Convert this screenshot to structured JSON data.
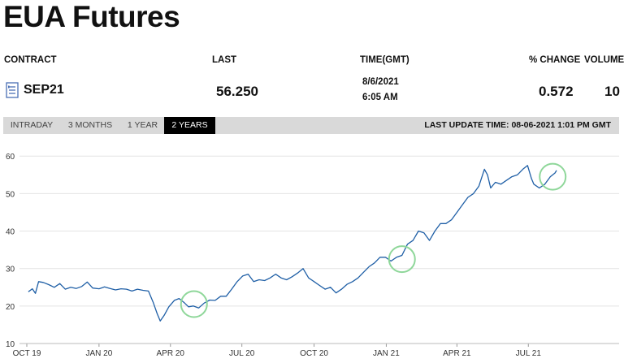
{
  "page_title": "EUA Futures",
  "table": {
    "headers": {
      "contract": "CONTRACT",
      "last": "LAST",
      "time": "TIME(GMT)",
      "change": "% CHANGE",
      "volume": "VOLUME"
    },
    "row": {
      "contract": "SEP21",
      "last": "56.250",
      "date": "8/6/2021",
      "time": "6:05 AM",
      "change": "0.572",
      "volume": "10"
    }
  },
  "tabs": [
    "INTRADAY",
    "3 MONTHS",
    "1 YEAR",
    "2 YEARS"
  ],
  "active_tab": "2 YEARS",
  "last_update": "LAST UPDATE TIME: 08-06-2021 1:01 PM GMT",
  "colors": {
    "line": "#1f5fa6",
    "highlight": "#8fd79a",
    "grid": "#e4e4e4"
  },
  "chart_data": {
    "type": "line",
    "title": "",
    "xlabel": "",
    "ylabel": "",
    "ylim": [
      10,
      62
    ],
    "yticks": [
      10,
      20,
      30,
      40,
      50,
      60
    ],
    "x_start": "2019-10-01",
    "x_ticks": [
      {
        "label": "OCT 19",
        "date": "2019-10-01"
      },
      {
        "label": "JAN 20",
        "date": "2020-01-01"
      },
      {
        "label": "APR 20",
        "date": "2020-04-01"
      },
      {
        "label": "JUL 20",
        "date": "2020-07-01"
      },
      {
        "label": "OCT 20",
        "date": "2020-10-01"
      },
      {
        "label": "JAN 21",
        "date": "2021-01-01"
      },
      {
        "label": "APR 21",
        "date": "2021-04-01"
      },
      {
        "label": "JUL 21",
        "date": "2021-07-01"
      }
    ],
    "grid": true,
    "series": [
      {
        "values": [
          [
            "2019-10-03",
            23.8
          ],
          [
            "2019-10-08",
            24.6
          ],
          [
            "2019-10-12",
            23.4
          ],
          [
            "2019-10-16",
            26.5
          ],
          [
            "2019-10-22",
            26.3
          ],
          [
            "2019-10-29",
            25.7
          ],
          [
            "2019-11-05",
            25.0
          ],
          [
            "2019-11-12",
            26.0
          ],
          [
            "2019-11-19",
            24.5
          ],
          [
            "2019-11-26",
            25.0
          ],
          [
            "2019-12-03",
            24.7
          ],
          [
            "2019-12-10",
            25.2
          ],
          [
            "2019-12-17",
            26.4
          ],
          [
            "2019-12-24",
            24.8
          ],
          [
            "2020-01-01",
            24.6
          ],
          [
            "2020-01-08",
            25.1
          ],
          [
            "2020-01-15",
            24.7
          ],
          [
            "2020-01-22",
            24.3
          ],
          [
            "2020-01-29",
            24.6
          ],
          [
            "2020-02-05",
            24.5
          ],
          [
            "2020-02-12",
            24.0
          ],
          [
            "2020-02-19",
            24.5
          ],
          [
            "2020-02-26",
            24.2
          ],
          [
            "2020-03-04",
            24.0
          ],
          [
            "2020-03-10",
            21.0
          ],
          [
            "2020-03-15",
            18.0
          ],
          [
            "2020-03-19",
            16.0
          ],
          [
            "2020-03-24",
            17.5
          ],
          [
            "2020-03-30",
            19.8
          ],
          [
            "2020-04-06",
            21.5
          ],
          [
            "2020-04-12",
            22.0
          ],
          [
            "2020-04-18",
            21.0
          ],
          [
            "2020-04-24",
            19.8
          ],
          [
            "2020-04-30",
            20.0
          ],
          [
            "2020-05-07",
            19.5
          ],
          [
            "2020-05-14",
            20.8
          ],
          [
            "2020-05-21",
            21.6
          ],
          [
            "2020-05-28",
            21.5
          ],
          [
            "2020-06-04",
            22.6
          ],
          [
            "2020-06-11",
            22.6
          ],
          [
            "2020-06-18",
            24.5
          ],
          [
            "2020-06-25",
            26.5
          ],
          [
            "2020-07-02",
            28.0
          ],
          [
            "2020-07-09",
            28.5
          ],
          [
            "2020-07-16",
            26.5
          ],
          [
            "2020-07-23",
            27.0
          ],
          [
            "2020-07-30",
            26.8
          ],
          [
            "2020-08-06",
            27.5
          ],
          [
            "2020-08-13",
            28.5
          ],
          [
            "2020-08-20",
            27.5
          ],
          [
            "2020-08-27",
            27.0
          ],
          [
            "2020-09-03",
            27.8
          ],
          [
            "2020-09-10",
            28.8
          ],
          [
            "2020-09-17",
            30.0
          ],
          [
            "2020-09-24",
            27.5
          ],
          [
            "2020-10-01",
            26.5
          ],
          [
            "2020-10-08",
            25.5
          ],
          [
            "2020-10-15",
            24.5
          ],
          [
            "2020-10-22",
            25.0
          ],
          [
            "2020-10-29",
            23.5
          ],
          [
            "2020-11-05",
            24.5
          ],
          [
            "2020-11-12",
            25.8
          ],
          [
            "2020-11-19",
            26.5
          ],
          [
            "2020-11-26",
            27.5
          ],
          [
            "2020-12-03",
            29.0
          ],
          [
            "2020-12-10",
            30.5
          ],
          [
            "2020-12-17",
            31.5
          ],
          [
            "2020-12-24",
            33.0
          ],
          [
            "2020-12-31",
            33.0
          ],
          [
            "2021-01-07",
            32.0
          ],
          [
            "2021-01-14",
            33.0
          ],
          [
            "2021-01-21",
            33.5
          ],
          [
            "2021-01-28",
            36.5
          ],
          [
            "2021-02-04",
            37.5
          ],
          [
            "2021-02-11",
            40.0
          ],
          [
            "2021-02-18",
            39.5
          ],
          [
            "2021-02-25",
            37.5
          ],
          [
            "2021-03-04",
            40.0
          ],
          [
            "2021-03-11",
            42.0
          ],
          [
            "2021-03-18",
            42.0
          ],
          [
            "2021-03-25",
            43.0
          ],
          [
            "2021-04-01",
            45.0
          ],
          [
            "2021-04-08",
            47.0
          ],
          [
            "2021-04-15",
            49.0
          ],
          [
            "2021-04-22",
            50.0
          ],
          [
            "2021-04-29",
            52.0
          ],
          [
            "2021-05-06",
            56.5
          ],
          [
            "2021-05-10",
            55.0
          ],
          [
            "2021-05-14",
            51.5
          ],
          [
            "2021-05-20",
            53.0
          ],
          [
            "2021-05-27",
            52.5
          ],
          [
            "2021-06-03",
            53.5
          ],
          [
            "2021-06-10",
            54.5
          ],
          [
            "2021-06-17",
            55.0
          ],
          [
            "2021-06-24",
            56.5
          ],
          [
            "2021-06-30",
            57.5
          ],
          [
            "2021-07-05",
            54.0
          ],
          [
            "2021-07-08",
            52.5
          ],
          [
            "2021-07-15",
            51.5
          ],
          [
            "2021-07-22",
            52.5
          ],
          [
            "2021-07-29",
            54.5
          ],
          [
            "2021-08-04",
            55.5
          ],
          [
            "2021-08-06",
            56.2
          ]
        ]
      }
    ],
    "highlights": [
      {
        "date": "2020-05-01",
        "value": 20.5
      },
      {
        "date": "2021-01-21",
        "value": 32.5
      },
      {
        "date": "2021-08-01",
        "value": 54.5
      }
    ]
  }
}
